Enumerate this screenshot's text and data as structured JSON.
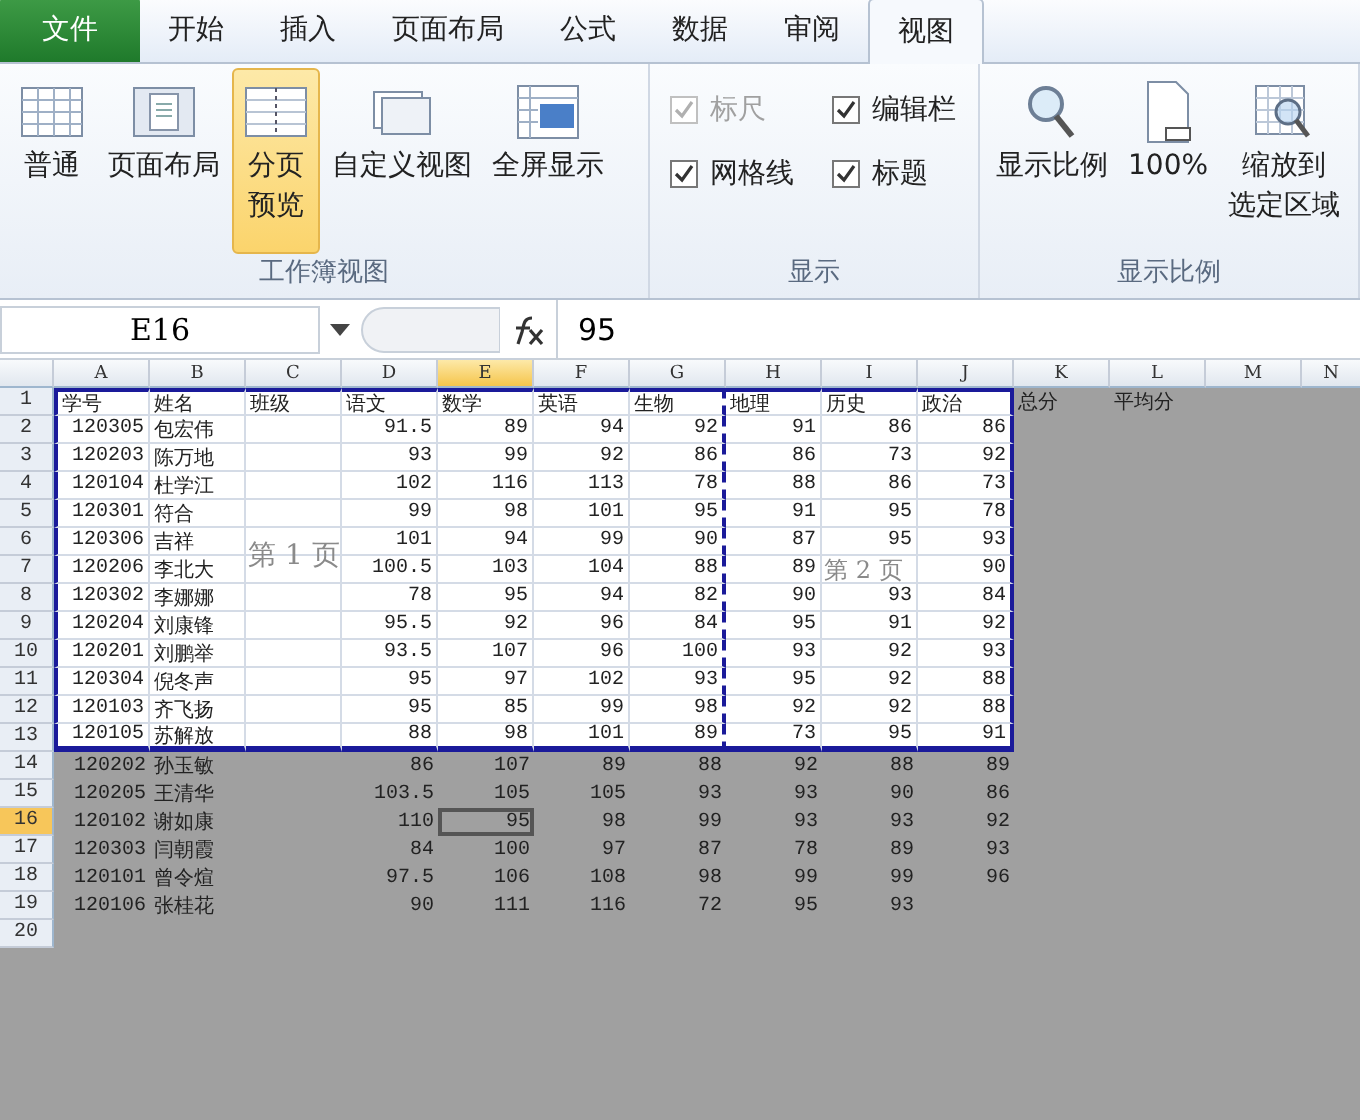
{
  "tabs": [
    {
      "label": "文件",
      "kind": "file",
      "selected": false
    },
    {
      "label": "开始",
      "kind": "tab",
      "selected": false
    },
    {
      "label": "插入",
      "kind": "tab",
      "selected": false
    },
    {
      "label": "页面布局",
      "kind": "tab",
      "selected": false
    },
    {
      "label": "公式",
      "kind": "tab",
      "selected": false
    },
    {
      "label": "数据",
      "kind": "tab",
      "selected": false
    },
    {
      "label": "审阅",
      "kind": "tab",
      "selected": false
    },
    {
      "label": "视图",
      "kind": "tab",
      "selected": true
    }
  ],
  "ribbon_groups": [
    {
      "name": "工作簿视图",
      "items": [
        {
          "kind": "button",
          "label": [
            "普通"
          ],
          "selected": false
        },
        {
          "kind": "button",
          "label": [
            "页面布局"
          ],
          "selected": false
        },
        {
          "kind": "button",
          "label": [
            "分页",
            "预览"
          ],
          "selected": true
        },
        {
          "kind": "button",
          "label": [
            "自定义视图"
          ],
          "selected": false
        },
        {
          "kind": "button",
          "label": [
            "全屏显示"
          ],
          "selected": false
        }
      ]
    },
    {
      "name": "显示",
      "items": [
        {
          "kind": "checkbox",
          "label": "标尺",
          "checked": true,
          "disabled": true
        },
        {
          "kind": "checkbox",
          "label": "编辑栏",
          "checked": true,
          "disabled": false
        },
        {
          "kind": "checkbox",
          "label": "网格线",
          "checked": true,
          "disabled": false
        },
        {
          "kind": "checkbox",
          "label": "标题",
          "checked": true,
          "disabled": false
        }
      ]
    },
    {
      "name": "显示比例",
      "items": [
        {
          "kind": "button",
          "label": [
            "显示比例"
          ],
          "selected": false
        },
        {
          "kind": "button",
          "label": [
            "100%"
          ],
          "selected": false
        },
        {
          "kind": "button",
          "label": [
            "缩放到",
            "选定区域"
          ],
          "selected": false
        }
      ]
    }
  ],
  "name_box": "E16",
  "formula": "95",
  "columns": [
    {
      "label": "A",
      "selected": false,
      "printed": true,
      "page_break_after": false
    },
    {
      "label": "B",
      "selected": false,
      "printed": true,
      "page_break_after": false
    },
    {
      "label": "C",
      "selected": false,
      "printed": true,
      "page_break_after": false
    },
    {
      "label": "D",
      "selected": false,
      "printed": true,
      "page_break_after": false
    },
    {
      "label": "E",
      "selected": true,
      "printed": true,
      "page_break_after": false
    },
    {
      "label": "F",
      "selected": false,
      "printed": true,
      "page_break_after": false
    },
    {
      "label": "G",
      "selected": false,
      "printed": true,
      "page_break_after": true
    },
    {
      "label": "H",
      "selected": false,
      "printed": true,
      "page_break_after": false
    },
    {
      "label": "I",
      "selected": false,
      "printed": true,
      "page_break_after": false
    },
    {
      "label": "J",
      "selected": false,
      "printed": true,
      "page_break_after": false
    },
    {
      "label": "K",
      "selected": false,
      "printed": false,
      "page_break_after": false
    },
    {
      "label": "L",
      "selected": false,
      "printed": false,
      "page_break_after": false
    },
    {
      "label": "M",
      "selected": false,
      "printed": false,
      "page_break_after": false
    },
    {
      "label": "N",
      "selected": false,
      "printed": false,
      "page_break_after": false
    }
  ],
  "rows": [
    {
      "number": "1",
      "selected": false,
      "printed": true,
      "cells": [
        "学号",
        "姓名",
        "班级",
        "语文",
        "数学",
        "英语",
        "生物",
        "地理",
        "历史",
        "政治",
        "总分",
        "平均分"
      ]
    },
    {
      "number": "2",
      "selected": false,
      "printed": true,
      "cells": [
        "120305",
        "包宏伟",
        "",
        "91.5",
        "89",
        "94",
        "92",
        "91",
        "86",
        "86"
      ]
    },
    {
      "number": "3",
      "selected": false,
      "printed": true,
      "cells": [
        "120203",
        "陈万地",
        "",
        "93",
        "99",
        "92",
        "86",
        "86",
        "73",
        "92"
      ]
    },
    {
      "number": "4",
      "selected": false,
      "printed": true,
      "cells": [
        "120104",
        "杜学江",
        "",
        "102",
        "116",
        "113",
        "78",
        "88",
        "86",
        "73"
      ]
    },
    {
      "number": "5",
      "selected": false,
      "printed": true,
      "cells": [
        "120301",
        "符合",
        "",
        "99",
        "98",
        "101",
        "95",
        "91",
        "95",
        "78"
      ]
    },
    {
      "number": "6",
      "selected": false,
      "printed": true,
      "cells": [
        "120306",
        "吉祥",
        "",
        "101",
        "94",
        "99",
        "90",
        "87",
        "95",
        "93"
      ]
    },
    {
      "number": "7",
      "selected": false,
      "printed": true,
      "cells": [
        "120206",
        "李北大",
        "",
        "100.5",
        "103",
        "104",
        "88",
        "89",
        "",
        "90"
      ]
    },
    {
      "number": "8",
      "selected": false,
      "printed": true,
      "cells": [
        "120302",
        "李娜娜",
        "",
        "78",
        "95",
        "94",
        "82",
        "90",
        "93",
        "84"
      ]
    },
    {
      "number": "9",
      "selected": false,
      "printed": true,
      "cells": [
        "120204",
        "刘康锋",
        "",
        "95.5",
        "92",
        "96",
        "84",
        "95",
        "91",
        "92"
      ]
    },
    {
      "number": "10",
      "selected": false,
      "printed": true,
      "cells": [
        "120201",
        "刘鹏举",
        "",
        "93.5",
        "107",
        "96",
        "100",
        "93",
        "92",
        "93"
      ]
    },
    {
      "number": "11",
      "selected": false,
      "printed": true,
      "cells": [
        "120304",
        "倪冬声",
        "",
        "95",
        "97",
        "102",
        "93",
        "95",
        "92",
        "88"
      ]
    },
    {
      "number": "12",
      "selected": false,
      "printed": true,
      "cells": [
        "120103",
        "齐飞扬",
        "",
        "95",
        "85",
        "99",
        "98",
        "92",
        "92",
        "88"
      ]
    },
    {
      "number": "13",
      "selected": false,
      "printed": true,
      "cells": [
        "120105",
        "苏解放",
        "",
        "88",
        "98",
        "101",
        "89",
        "73",
        "95",
        "91"
      ]
    },
    {
      "number": "14",
      "selected": false,
      "printed": false,
      "cells": [
        "120202",
        "孙玉敏",
        "",
        "86",
        "107",
        "89",
        "88",
        "92",
        "88",
        "89"
      ]
    },
    {
      "number": "15",
      "selected": false,
      "printed": false,
      "cells": [
        "120205",
        "王清华",
        "",
        "103.5",
        "105",
        "105",
        "93",
        "93",
        "90",
        "86"
      ]
    },
    {
      "number": "16",
      "selected": true,
      "printed": false,
      "cells": [
        "120102",
        "谢如康",
        "",
        "110",
        "95",
        "98",
        "99",
        "93",
        "93",
        "92"
      ]
    },
    {
      "number": "17",
      "selected": false,
      "printed": false,
      "cells": [
        "120303",
        "闫朝霞",
        "",
        "84",
        "100",
        "97",
        "87",
        "78",
        "89",
        "93"
      ]
    },
    {
      "number": "18",
      "selected": false,
      "printed": false,
      "cells": [
        "120101",
        "曾令煊",
        "",
        "97.5",
        "106",
        "108",
        "98",
        "99",
        "99",
        "96"
      ]
    },
    {
      "number": "19",
      "selected": false,
      "printed": false,
      "cells": [
        "120106",
        "张桂花",
        "",
        "90",
        "111",
        "116",
        "72",
        "95",
        "93"
      ]
    },
    {
      "number": "20",
      "selected": false,
      "printed": false,
      "cells": []
    }
  ],
  "page_labels": [
    {
      "text": "第 1 页"
    },
    {
      "text": "第 2 页"
    }
  ]
}
